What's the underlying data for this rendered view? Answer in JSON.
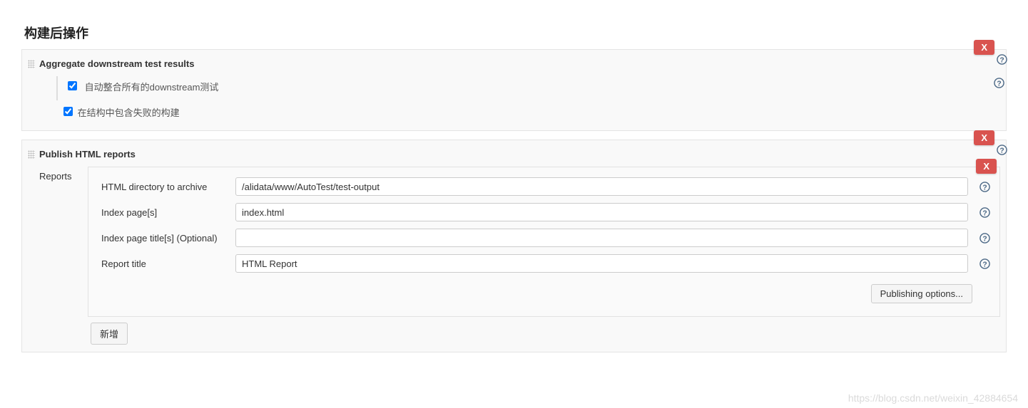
{
  "section_title": "构建后操作",
  "delete_label": "X",
  "blocks": {
    "aggregate": {
      "title": "Aggregate downstream test results",
      "auto_label": "自动整合所有的downstream测试",
      "auto_checked": true,
      "include_failed_label": "在结构中包含失败的构建",
      "include_failed_checked": true
    },
    "publish": {
      "title": "Publish HTML reports",
      "reports_label": "Reports",
      "fields": {
        "dir": {
          "label": "HTML directory to archive",
          "value": "/alidata/www/AutoTest/test-output"
        },
        "index": {
          "label": "Index page[s]",
          "value": "index.html"
        },
        "titles": {
          "label": "Index page title[s] (Optional)",
          "value": ""
        },
        "report_title": {
          "label": "Report title",
          "value": "HTML Report"
        }
      },
      "publishing_options": "Publishing options...",
      "add_label": "新增"
    }
  },
  "watermark": "https://blog.csdn.net/weixin_42884654"
}
